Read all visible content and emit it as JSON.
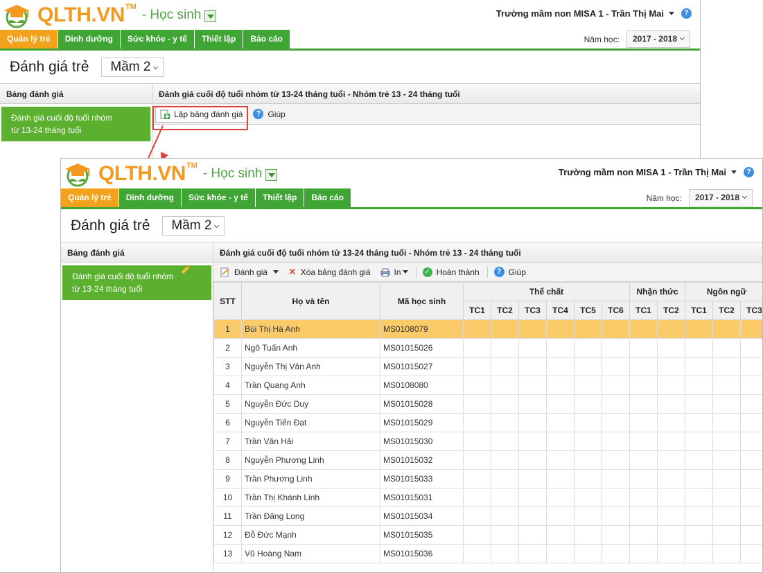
{
  "app": {
    "logo_text": "QLTH.VN",
    "logo_tm": "TM",
    "module": "- Học sinh",
    "user": "Trường mầm non MISA 1 - Trần Thị Mai",
    "tabs": [
      "Quản lý trẻ",
      "Dinh dưỡng",
      "Sức khỏe - y tế",
      "Thiết lập",
      "Báo cáo"
    ],
    "year_label": "Năm học:",
    "year_value": "2017 - 2018"
  },
  "page": {
    "title": "Đánh giá trẻ",
    "class": "Mầm 2",
    "left_header": "Bảng đánh giá",
    "left_item_line1": "Đánh giá cuối độ tuổi nhóm",
    "left_item_line2": "từ 13-24 tháng tuổi",
    "right_header": "Đánh giá cuối độ tuổi nhóm từ 13-24 tháng tuổi - Nhóm trẻ 13 - 24 tháng tuổi"
  },
  "back_toolbar": {
    "create": "Lập bảng đánh giá",
    "help": "Giúp"
  },
  "front_toolbar": {
    "evaluate": "Đánh giá",
    "delete": "Xóa bảng đánh giá",
    "print": "In",
    "done": "Hoàn thành",
    "help": "Giúp"
  },
  "table": {
    "col_stt": "STT",
    "col_name": "Họ và tên",
    "col_code": "Mã học sinh",
    "groups": [
      {
        "label": "Thể chất",
        "cols": [
          "TC1",
          "TC2",
          "TC3",
          "TC4",
          "TC5",
          "TC6"
        ]
      },
      {
        "label": "Nhận thức",
        "cols": [
          "TC1",
          "TC2"
        ]
      },
      {
        "label": "Ngôn ngữ",
        "cols": [
          "TC1",
          "TC2",
          "TC3"
        ]
      }
    ],
    "rows": [
      {
        "stt": "1",
        "name": "Bùi Thị Hà Anh",
        "code": "MS0108079"
      },
      {
        "stt": "2",
        "name": "Ngô Tuấn Anh",
        "code": "MS01015026"
      },
      {
        "stt": "3",
        "name": "Nguyễn Thị Vân Anh",
        "code": "MS01015027"
      },
      {
        "stt": "4",
        "name": "Trần Quang Anh",
        "code": "MS0108080"
      },
      {
        "stt": "5",
        "name": "Nguyễn Đức Duy",
        "code": "MS01015028"
      },
      {
        "stt": "6",
        "name": "Nguyễn Tiến Đạt",
        "code": "MS01015029"
      },
      {
        "stt": "7",
        "name": "Trần Văn Hải",
        "code": "MS01015030"
      },
      {
        "stt": "8",
        "name": "Nguyễn Phương Linh",
        "code": "MS01015032"
      },
      {
        "stt": "9",
        "name": "Trần Phương Linh",
        "code": "MS01015033"
      },
      {
        "stt": "10",
        "name": "Trần Thị Khánh Linh",
        "code": "MS01015031"
      },
      {
        "stt": "11",
        "name": "Trần Đăng Long",
        "code": "MS01015034"
      },
      {
        "stt": "12",
        "name": "Đỗ Đức Mạnh",
        "code": "MS01015035"
      },
      {
        "stt": "13",
        "name": "Vũ Hoàng Nam",
        "code": "MS01015036"
      }
    ],
    "selected_row": 0
  },
  "colors": {
    "brand_orange": "#f39a1e",
    "brand_green": "#3fa534",
    "selected_row": "#fbcb6a",
    "callout_red": "#e0423a"
  }
}
